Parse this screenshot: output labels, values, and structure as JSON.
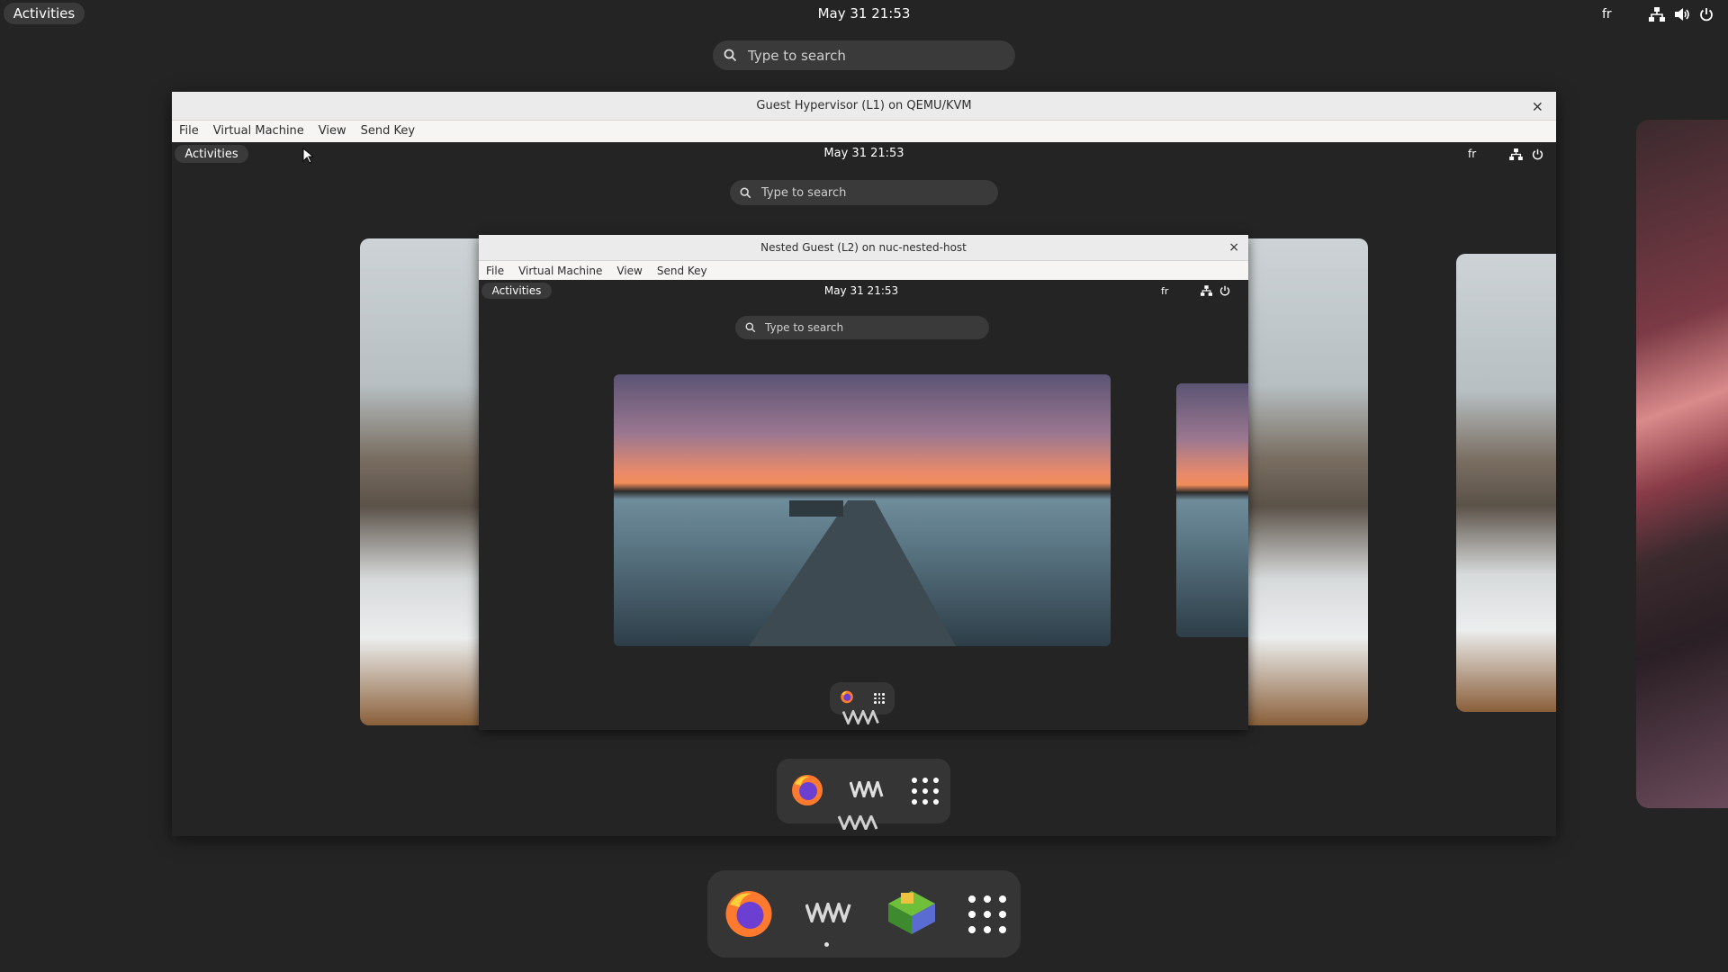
{
  "host": {
    "activities": "Activities",
    "clock": "May 31  21:53",
    "keyboard": "fr",
    "search_placeholder": "Type to search"
  },
  "l1_window": {
    "title": "Guest Hypervisor (L1) on QEMU/KVM",
    "close": "×",
    "menu": [
      "File",
      "Virtual Machine",
      "View",
      "Send Key"
    ],
    "activities": "Activities",
    "clock": "May 31  21:53",
    "keyboard": "fr",
    "search_placeholder": "Type to search"
  },
  "l2_window": {
    "title": "Nested Guest (L2) on nuc-nested-host",
    "close": "×",
    "menu": [
      "File",
      "Virtual Machine",
      "View",
      "Send Key"
    ],
    "activities": "Activities",
    "clock": "May 31  21:53",
    "keyboard": "fr",
    "search_placeholder": "Type to search"
  },
  "host_dock": {
    "apps": [
      "firefox-icon",
      "virt-manager-icon",
      "software-icon",
      "app-grid-icon"
    ]
  },
  "colors": {
    "shell_bg": "#242424",
    "pill_bg": "#3a3a3a",
    "dock_bg": "#353535",
    "titlebar_bg": "#ebebeb"
  }
}
